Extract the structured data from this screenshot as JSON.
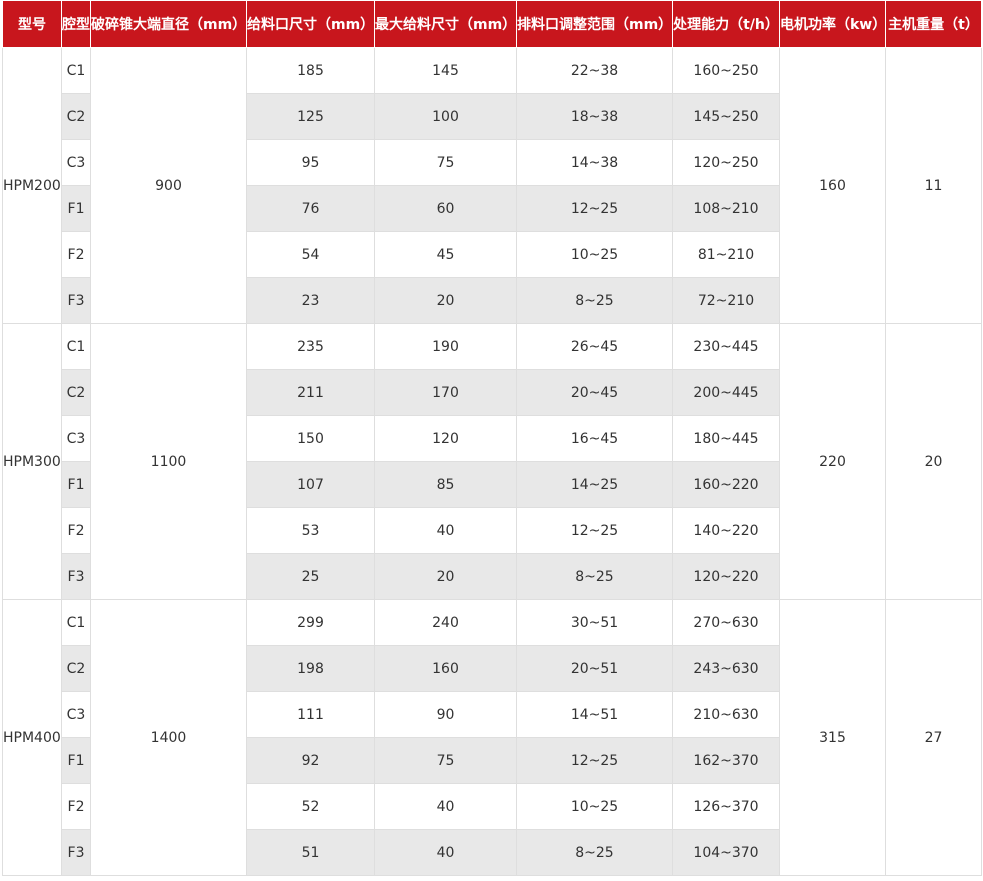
{
  "headers": [
    "型号",
    "腔型",
    "破碎锥大端直径（mm）",
    "给料口尺寸（mm）",
    "最大给料尺寸（mm）",
    "排料口调整范围（mm）",
    "处理能力（t/h）",
    "电机功率（kw）",
    "主机重量（t）"
  ],
  "groups": [
    {
      "model": "HPM200",
      "diameter": "900",
      "power": "160",
      "weight": "11",
      "rows": [
        {
          "cavity": "C1",
          "feed": "185",
          "max_feed": "145",
          "discharge": "22~38",
          "capacity": "160~250"
        },
        {
          "cavity": "C2",
          "feed": "125",
          "max_feed": "100",
          "discharge": "18~38",
          "capacity": "145~250"
        },
        {
          "cavity": "C3",
          "feed": "95",
          "max_feed": "75",
          "discharge": "14~38",
          "capacity": "120~250"
        },
        {
          "cavity": "F1",
          "feed": "76",
          "max_feed": "60",
          "discharge": "12~25",
          "capacity": "108~210"
        },
        {
          "cavity": "F2",
          "feed": "54",
          "max_feed": "45",
          "discharge": "10~25",
          "capacity": "81~210"
        },
        {
          "cavity": "F3",
          "feed": "23",
          "max_feed": "20",
          "discharge": "8~25",
          "capacity": "72~210"
        }
      ]
    },
    {
      "model": "HPM300",
      "diameter": "1100",
      "power": "220",
      "weight": "20",
      "rows": [
        {
          "cavity": "C1",
          "feed": "235",
          "max_feed": "190",
          "discharge": "26~45",
          "capacity": "230~445"
        },
        {
          "cavity": "C2",
          "feed": "211",
          "max_feed": "170",
          "discharge": "20~45",
          "capacity": "200~445"
        },
        {
          "cavity": "C3",
          "feed": "150",
          "max_feed": "120",
          "discharge": "16~45",
          "capacity": "180~445"
        },
        {
          "cavity": "F1",
          "feed": "107",
          "max_feed": "85",
          "discharge": "14~25",
          "capacity": "160~220"
        },
        {
          "cavity": "F2",
          "feed": "53",
          "max_feed": "40",
          "discharge": "12~25",
          "capacity": "140~220"
        },
        {
          "cavity": "F3",
          "feed": "25",
          "max_feed": "20",
          "discharge": "8~25",
          "capacity": "120~220"
        }
      ]
    },
    {
      "model": "HPM400",
      "diameter": "1400",
      "power": "315",
      "weight": "27",
      "rows": [
        {
          "cavity": "C1",
          "feed": "299",
          "max_feed": "240",
          "discharge": "30~51",
          "capacity": "270~630"
        },
        {
          "cavity": "C2",
          "feed": "198",
          "max_feed": "160",
          "discharge": "20~51",
          "capacity": "243~630"
        },
        {
          "cavity": "C3",
          "feed": "111",
          "max_feed": "90",
          "discharge": "14~51",
          "capacity": "210~630"
        },
        {
          "cavity": "F1",
          "feed": "92",
          "max_feed": "75",
          "discharge": "12~25",
          "capacity": "162~370"
        },
        {
          "cavity": "F2",
          "feed": "52",
          "max_feed": "40",
          "discharge": "10~25",
          "capacity": "126~370"
        },
        {
          "cavity": "F3",
          "feed": "51",
          "max_feed": "40",
          "discharge": "8~25",
          "capacity": "104~370"
        }
      ]
    }
  ],
  "colors": {
    "header_bg": "#c8161d",
    "header_text": "#ffffff",
    "stripe": "#e8e8e8",
    "border": "#dedede"
  }
}
